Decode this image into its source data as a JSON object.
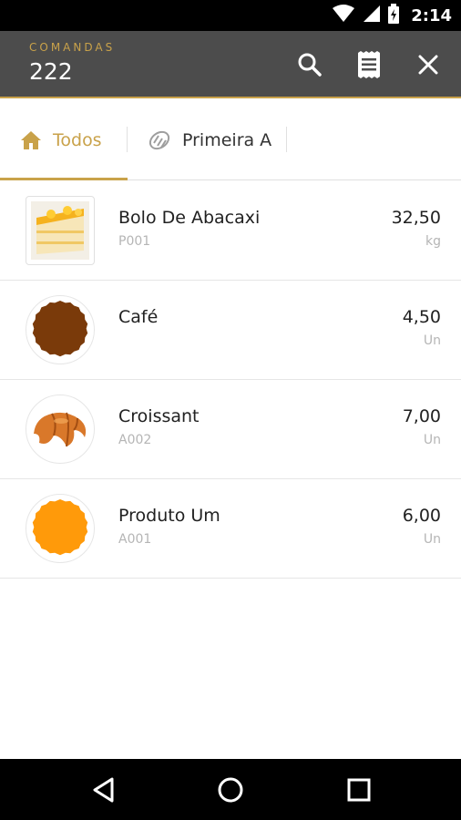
{
  "status_bar": {
    "time": "2:14",
    "icons": [
      "wifi-icon",
      "signal-icon",
      "battery-charging-icon"
    ]
  },
  "app_bar": {
    "caption": "COMANDAS",
    "title": "222",
    "actions": [
      "search-icon",
      "receipt-icon",
      "close-icon"
    ],
    "colors": {
      "background": "#4c4c4c",
      "accent": "#c9a24a"
    }
  },
  "tabs": [
    {
      "label": "Todos",
      "icon": "home-icon",
      "selected": true
    },
    {
      "label": "Primeira A",
      "icon": "bread-icon",
      "selected": false
    }
  ],
  "products": [
    {
      "name": "Bolo De Abacaxi",
      "code": "P001",
      "price": "32,50",
      "unit": "kg",
      "image": "cake-slice-photo"
    },
    {
      "name": "Café",
      "code": "",
      "price": "4,50",
      "unit": "Un",
      "image": "brown-badge",
      "color": "#7a3a0a"
    },
    {
      "name": "Croissant",
      "code": "A002",
      "price": "7,00",
      "unit": "Un",
      "image": "croissant-photo"
    },
    {
      "name": "Produto Um",
      "code": "A001",
      "price": "6,00",
      "unit": "Un",
      "image": "orange-badge",
      "color": "#ff9a0a"
    }
  ],
  "nav_bar": {
    "buttons": [
      "back-icon",
      "home-circle-icon",
      "recents-icon"
    ]
  }
}
